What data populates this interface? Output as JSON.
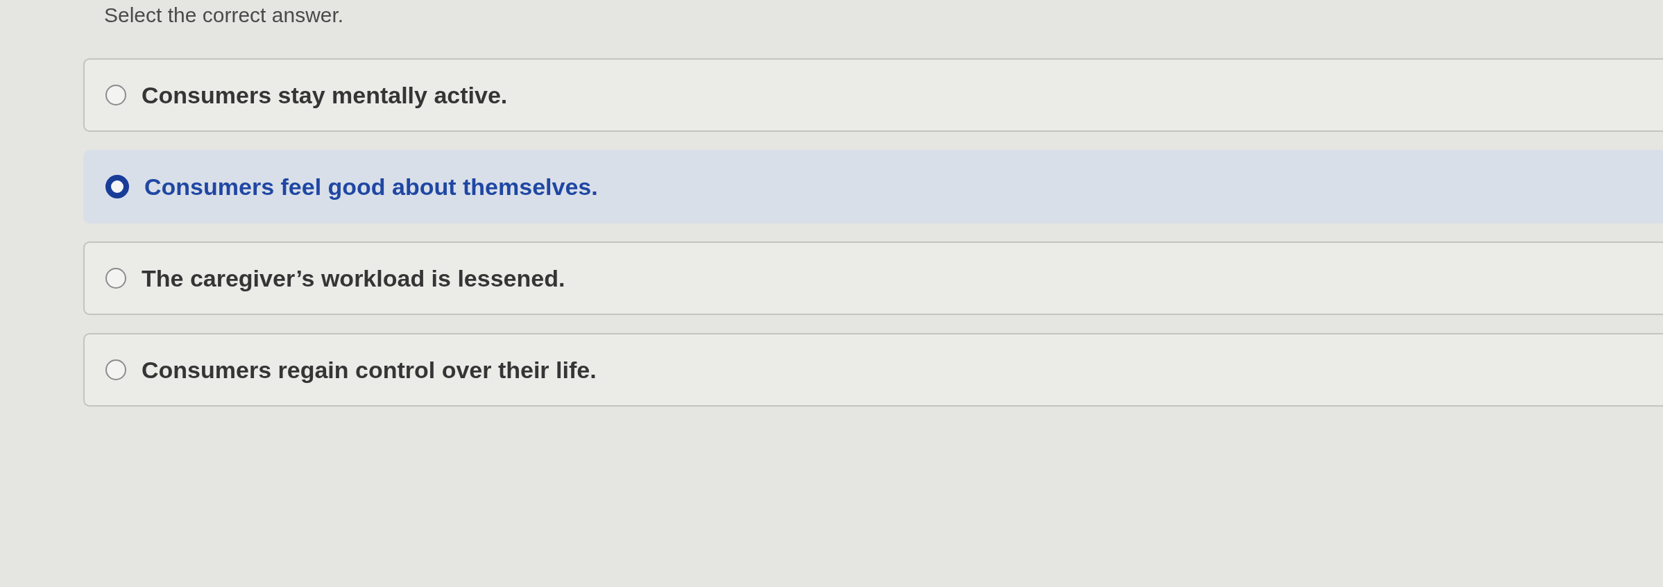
{
  "instruction": "Select the correct answer.",
  "options": [
    {
      "label": "Consumers stay mentally active.",
      "selected": false
    },
    {
      "label": "Consumers feel good about themselves.",
      "selected": true
    },
    {
      "label": "The caregiver’s workload is lessened.",
      "selected": false
    },
    {
      "label": "Consumers regain control over their life.",
      "selected": false
    }
  ]
}
